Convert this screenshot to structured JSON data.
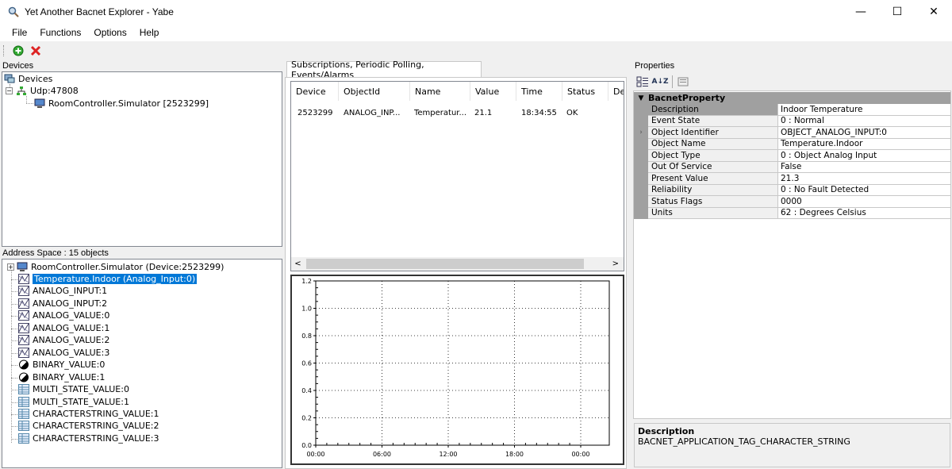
{
  "window": {
    "title": "Yet Another Bacnet Explorer - Yabe",
    "minimize": "—",
    "maximize": "☐",
    "close": "✕"
  },
  "menu": [
    "File",
    "Functions",
    "Options",
    "Help"
  ],
  "devices": {
    "label": "Devices",
    "root": "Devices",
    "port": "Udp:47808",
    "device": "RoomController.Simulator [2523299]"
  },
  "address_space": {
    "label": "Address Space : 15 objects",
    "root": "RoomController.Simulator (Device:2523299)",
    "items": [
      {
        "label": "Temperature.Indoor (Analog_Input:0)",
        "kind": "analog",
        "selected": true
      },
      {
        "label": "ANALOG_INPUT:1",
        "kind": "analog"
      },
      {
        "label": "ANALOG_INPUT:2",
        "kind": "analog"
      },
      {
        "label": "ANALOG_VALUE:0",
        "kind": "analog"
      },
      {
        "label": "ANALOG_VALUE:1",
        "kind": "analog"
      },
      {
        "label": "ANALOG_VALUE:2",
        "kind": "analog"
      },
      {
        "label": "ANALOG_VALUE:3",
        "kind": "analog"
      },
      {
        "label": "BINARY_VALUE:0",
        "kind": "binary"
      },
      {
        "label": "BINARY_VALUE:1",
        "kind": "binary"
      },
      {
        "label": "MULTI_STATE_VALUE:0",
        "kind": "multi"
      },
      {
        "label": "MULTI_STATE_VALUE:1",
        "kind": "multi"
      },
      {
        "label": "CHARACTERSTRING_VALUE:1",
        "kind": "multi"
      },
      {
        "label": "CHARACTERSTRING_VALUE:2",
        "kind": "multi"
      },
      {
        "label": "CHARACTERSTRING_VALUE:3",
        "kind": "multi"
      }
    ]
  },
  "subscriptions": {
    "tab": "Subscriptions, Periodic Polling, Events/Alarms",
    "columns": [
      "Device",
      "ObjectId",
      "Name",
      "Value",
      "Time",
      "Status",
      "De"
    ],
    "rows": [
      [
        "2523299",
        "ANALOG_INP...",
        "Temperatur...",
        "21.1",
        "18:34:55",
        "OK",
        ""
      ]
    ]
  },
  "chart_data": {
    "type": "line",
    "title": "",
    "xlabel": "",
    "ylabel": "",
    "x_ticks": [
      "00:00",
      "06:00",
      "12:00",
      "18:00",
      "00:00"
    ],
    "y_ticks": [
      "0.0",
      "0.2",
      "0.4",
      "0.6",
      "0.8",
      "1.0",
      "1.2"
    ],
    "ylim": [
      0,
      1.2
    ],
    "grid": true,
    "series": []
  },
  "properties": {
    "label": "Properties",
    "category": "BacnetProperty",
    "rows": [
      {
        "name": "Description",
        "value": "Indoor Temperature",
        "selected": true
      },
      {
        "name": "Event State",
        "value": "0 : Normal"
      },
      {
        "name": "Object Identifier",
        "value": "OBJECT_ANALOG_INPUT:0",
        "expandable": true
      },
      {
        "name": "Object Name",
        "value": "Temperature.Indoor"
      },
      {
        "name": "Object Type",
        "value": "0 : Object Analog Input"
      },
      {
        "name": "Out Of Service",
        "value": "False"
      },
      {
        "name": "Present Value",
        "value": "21.3"
      },
      {
        "name": "Reliability",
        "value": "0 : No Fault Detected"
      },
      {
        "name": "Status Flags",
        "value": "0000"
      },
      {
        "name": "Units",
        "value": "62 : Degrees Celsius"
      }
    ],
    "description_title": "Description",
    "description_text": "BACNET_APPLICATION_TAG_CHARACTER_STRING"
  }
}
